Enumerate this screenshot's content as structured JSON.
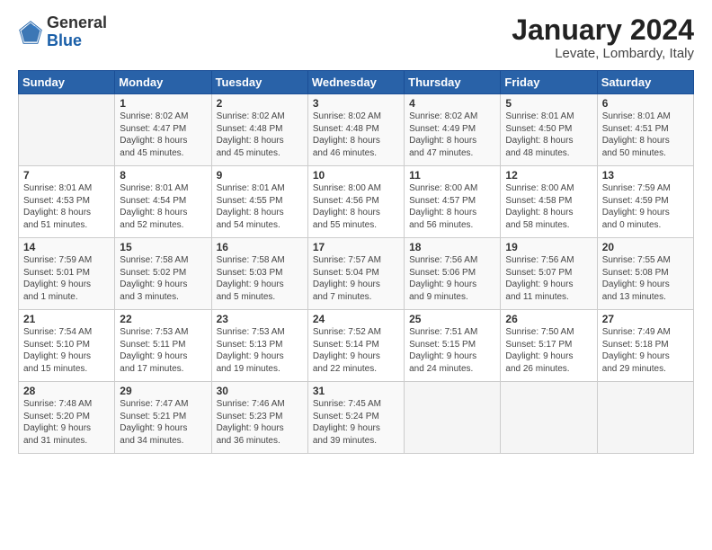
{
  "logo": {
    "general": "General",
    "blue": "Blue"
  },
  "header": {
    "month": "January 2024",
    "location": "Levate, Lombardy, Italy"
  },
  "weekdays": [
    "Sunday",
    "Monday",
    "Tuesday",
    "Wednesday",
    "Thursday",
    "Friday",
    "Saturday"
  ],
  "weeks": [
    [
      {
        "day": "",
        "info": ""
      },
      {
        "day": "1",
        "info": "Sunrise: 8:02 AM\nSunset: 4:47 PM\nDaylight: 8 hours\nand 45 minutes."
      },
      {
        "day": "2",
        "info": "Sunrise: 8:02 AM\nSunset: 4:48 PM\nDaylight: 8 hours\nand 45 minutes."
      },
      {
        "day": "3",
        "info": "Sunrise: 8:02 AM\nSunset: 4:48 PM\nDaylight: 8 hours\nand 46 minutes."
      },
      {
        "day": "4",
        "info": "Sunrise: 8:02 AM\nSunset: 4:49 PM\nDaylight: 8 hours\nand 47 minutes."
      },
      {
        "day": "5",
        "info": "Sunrise: 8:01 AM\nSunset: 4:50 PM\nDaylight: 8 hours\nand 48 minutes."
      },
      {
        "day": "6",
        "info": "Sunrise: 8:01 AM\nSunset: 4:51 PM\nDaylight: 8 hours\nand 50 minutes."
      }
    ],
    [
      {
        "day": "7",
        "info": "Sunrise: 8:01 AM\nSunset: 4:53 PM\nDaylight: 8 hours\nand 51 minutes."
      },
      {
        "day": "8",
        "info": "Sunrise: 8:01 AM\nSunset: 4:54 PM\nDaylight: 8 hours\nand 52 minutes."
      },
      {
        "day": "9",
        "info": "Sunrise: 8:01 AM\nSunset: 4:55 PM\nDaylight: 8 hours\nand 54 minutes."
      },
      {
        "day": "10",
        "info": "Sunrise: 8:00 AM\nSunset: 4:56 PM\nDaylight: 8 hours\nand 55 minutes."
      },
      {
        "day": "11",
        "info": "Sunrise: 8:00 AM\nSunset: 4:57 PM\nDaylight: 8 hours\nand 56 minutes."
      },
      {
        "day": "12",
        "info": "Sunrise: 8:00 AM\nSunset: 4:58 PM\nDaylight: 8 hours\nand 58 minutes."
      },
      {
        "day": "13",
        "info": "Sunrise: 7:59 AM\nSunset: 4:59 PM\nDaylight: 9 hours\nand 0 minutes."
      }
    ],
    [
      {
        "day": "14",
        "info": "Sunrise: 7:59 AM\nSunset: 5:01 PM\nDaylight: 9 hours\nand 1 minute."
      },
      {
        "day": "15",
        "info": "Sunrise: 7:58 AM\nSunset: 5:02 PM\nDaylight: 9 hours\nand 3 minutes."
      },
      {
        "day": "16",
        "info": "Sunrise: 7:58 AM\nSunset: 5:03 PM\nDaylight: 9 hours\nand 5 minutes."
      },
      {
        "day": "17",
        "info": "Sunrise: 7:57 AM\nSunset: 5:04 PM\nDaylight: 9 hours\nand 7 minutes."
      },
      {
        "day": "18",
        "info": "Sunrise: 7:56 AM\nSunset: 5:06 PM\nDaylight: 9 hours\nand 9 minutes."
      },
      {
        "day": "19",
        "info": "Sunrise: 7:56 AM\nSunset: 5:07 PM\nDaylight: 9 hours\nand 11 minutes."
      },
      {
        "day": "20",
        "info": "Sunrise: 7:55 AM\nSunset: 5:08 PM\nDaylight: 9 hours\nand 13 minutes."
      }
    ],
    [
      {
        "day": "21",
        "info": "Sunrise: 7:54 AM\nSunset: 5:10 PM\nDaylight: 9 hours\nand 15 minutes."
      },
      {
        "day": "22",
        "info": "Sunrise: 7:53 AM\nSunset: 5:11 PM\nDaylight: 9 hours\nand 17 minutes."
      },
      {
        "day": "23",
        "info": "Sunrise: 7:53 AM\nSunset: 5:13 PM\nDaylight: 9 hours\nand 19 minutes."
      },
      {
        "day": "24",
        "info": "Sunrise: 7:52 AM\nSunset: 5:14 PM\nDaylight: 9 hours\nand 22 minutes."
      },
      {
        "day": "25",
        "info": "Sunrise: 7:51 AM\nSunset: 5:15 PM\nDaylight: 9 hours\nand 24 minutes."
      },
      {
        "day": "26",
        "info": "Sunrise: 7:50 AM\nSunset: 5:17 PM\nDaylight: 9 hours\nand 26 minutes."
      },
      {
        "day": "27",
        "info": "Sunrise: 7:49 AM\nSunset: 5:18 PM\nDaylight: 9 hours\nand 29 minutes."
      }
    ],
    [
      {
        "day": "28",
        "info": "Sunrise: 7:48 AM\nSunset: 5:20 PM\nDaylight: 9 hours\nand 31 minutes."
      },
      {
        "day": "29",
        "info": "Sunrise: 7:47 AM\nSunset: 5:21 PM\nDaylight: 9 hours\nand 34 minutes."
      },
      {
        "day": "30",
        "info": "Sunrise: 7:46 AM\nSunset: 5:23 PM\nDaylight: 9 hours\nand 36 minutes."
      },
      {
        "day": "31",
        "info": "Sunrise: 7:45 AM\nSunset: 5:24 PM\nDaylight: 9 hours\nand 39 minutes."
      },
      {
        "day": "",
        "info": ""
      },
      {
        "day": "",
        "info": ""
      },
      {
        "day": "",
        "info": ""
      }
    ]
  ]
}
